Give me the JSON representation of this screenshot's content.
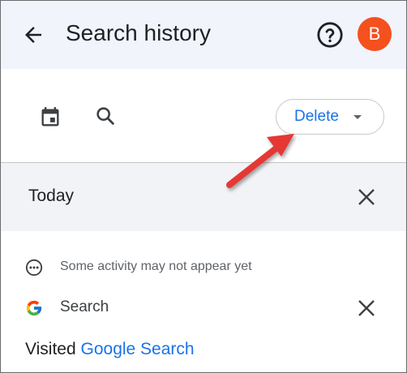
{
  "header": {
    "title": "Search history",
    "avatar_letter": "B",
    "avatar_color": "#f4511e"
  },
  "icons": {
    "back": "arrow-left",
    "help": "question-circle",
    "calendar": "calendar",
    "search": "magnifier",
    "close": "x",
    "more": "ellipsis-circle",
    "logo": "google-g"
  },
  "toolbar": {
    "delete_label": "Delete"
  },
  "day": {
    "title": "Today"
  },
  "notice": {
    "text": "Some activity may not appear yet"
  },
  "item": {
    "title": "Search",
    "visited_prefix": "Visited",
    "visited_link": "Google Search"
  },
  "colors": {
    "accent": "#1a73e8",
    "annotation_arrow": "#e53935"
  }
}
